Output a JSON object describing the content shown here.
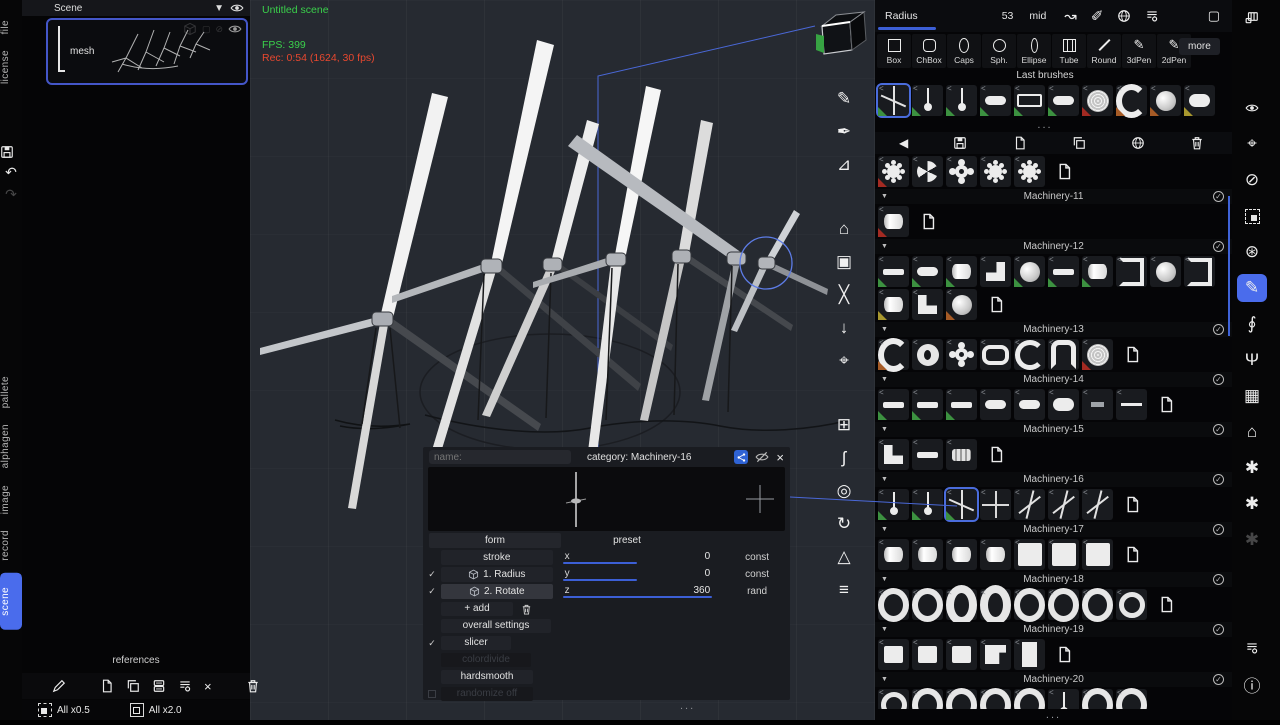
{
  "accent": {
    "blue": "#4a6cec",
    "slider": "#3c5fd6",
    "green": "#3ad04b",
    "red": "#e8482f"
  },
  "left_tabs": {
    "top": [
      {
        "label": "file"
      },
      {
        "label": "license"
      }
    ],
    "bottom": [
      {
        "label": "pallete"
      },
      {
        "label": "alphagen"
      },
      {
        "label": "image"
      },
      {
        "label": "record"
      },
      {
        "label": "scene",
        "active": true
      }
    ],
    "icons": [
      {
        "name": "save-icon",
        "glyph": "svg:floppy"
      },
      {
        "name": "undo-icon",
        "glyph": "↶"
      },
      {
        "name": "redo-icon",
        "glyph": "↷",
        "dim": true
      }
    ]
  },
  "scene_panel": {
    "title": "Scene",
    "mesh_label": "mesh",
    "references_label": "references",
    "scale_down_label": "All x0.5",
    "scale_up_label": "All x2.0",
    "header_icons": [
      {
        "name": "dropdown-arrow-icon",
        "glyph": "▼"
      },
      {
        "name": "visibility-eye-icon",
        "glyph": "svg:eye"
      }
    ],
    "item_icons": [
      {
        "name": "ghost-cube-icon",
        "glyph": "svg:cube",
        "dim": true
      },
      {
        "name": "ghost-frame-icon",
        "glyph": "▢",
        "dim": true
      },
      {
        "name": "ghost-hide-icon",
        "glyph": "⊘",
        "dim": true
      },
      {
        "name": "item-eye-icon",
        "glyph": "svg:eye"
      }
    ],
    "toolbar_icons": [
      {
        "name": "draw-icon",
        "glyph": "svg:pen"
      },
      {
        "name": "new-file-icon",
        "glyph": "svg:file",
        "gap": true
      },
      {
        "name": "duplicate-icon",
        "glyph": "svg:copy"
      },
      {
        "name": "layers-icon",
        "glyph": "svg:layers"
      },
      {
        "name": "list-settings-icon",
        "glyph": "svg:listgear"
      },
      {
        "name": "close-icon",
        "glyph": "×"
      },
      {
        "name": "trash-icon",
        "glyph": "svg:trash",
        "gap": true
      }
    ]
  },
  "viewport": {
    "scene_name": "Untitled scene",
    "fps": "FPS: 399",
    "rec": "Rec: 0:54 (1624, 30 fps)",
    "ellipsis": "..."
  },
  "middle_toolbar": [
    {
      "name": "pen-tool-icon",
      "glyph": "✎"
    },
    {
      "name": "mask-pen-icon",
      "glyph": "✒"
    },
    {
      "name": "chart-icon",
      "glyph": "⊿"
    },
    {
      "name": "home-icon",
      "glyph": "⌂",
      "gap": true
    },
    {
      "name": "frame-icon",
      "glyph": "▣"
    },
    {
      "name": "shuffle-icon",
      "glyph": "╳"
    },
    {
      "name": "arrow-down-icon",
      "glyph": "↓"
    },
    {
      "name": "move-icon",
      "glyph": "⌖"
    },
    {
      "name": "select-box-icon",
      "glyph": "⊞",
      "gap": true
    },
    {
      "name": "lasso-icon",
      "glyph": "ʃ"
    },
    {
      "name": "gyro-icon",
      "glyph": "◎"
    },
    {
      "name": "rotate-sphere-icon",
      "glyph": "↻"
    },
    {
      "name": "cone-icon",
      "glyph": "△"
    },
    {
      "name": "settings-list-icon",
      "glyph": "≡"
    }
  ],
  "right_toolbar": [
    {
      "name": "panels-icon",
      "glyph": "svg:panels"
    },
    {
      "name": "eye-icon",
      "glyph": "svg:eye",
      "gap": "lg"
    },
    {
      "name": "transform-move-icon",
      "glyph": "⌖"
    },
    {
      "name": "no-draw-icon",
      "glyph": "⊘"
    },
    {
      "name": "select-area-icon",
      "glyph": "css:selbox"
    },
    {
      "name": "grid-sphere-icon",
      "glyph": "⊛"
    },
    {
      "name": "pen-tool-icon",
      "glyph": "✎",
      "active": true
    },
    {
      "name": "lathe-icon",
      "glyph": "∮"
    },
    {
      "name": "plant-icon",
      "glyph": "Ψ"
    },
    {
      "name": "pattern-icon",
      "glyph": "▦"
    },
    {
      "name": "home-icon",
      "glyph": "⌂"
    },
    {
      "name": "nodes-icon",
      "glyph": "✱"
    },
    {
      "name": "nodes2-icon",
      "glyph": "✱"
    },
    {
      "name": "ghost-nodes-icon",
      "glyph": "✱",
      "dim": true
    },
    {
      "name": "settings-list-icon",
      "glyph": "svg:listgear",
      "gap": "xl"
    },
    {
      "name": "info-icon",
      "glyph": "ⓘ"
    }
  ],
  "top_bar": {
    "radius_label": "Radius",
    "radius_value": "53",
    "radius_mode": "mid",
    "icons": [
      {
        "name": "pose-path-icon",
        "glyph": "↝"
      },
      {
        "name": "pencil-ruler-icon",
        "glyph": "✐"
      },
      {
        "name": "globe-brush-icon",
        "glyph": "svg:globe"
      },
      {
        "name": "settings-list-icon",
        "glyph": "svg:listgear"
      }
    ],
    "window_icon": {
      "name": "window-icon",
      "glyph": "▢"
    }
  },
  "brush_types": {
    "items": [
      {
        "label": "Box",
        "icon": "box"
      },
      {
        "label": "ChBox",
        "icon": "chbox"
      },
      {
        "label": "Caps",
        "icon": "caps"
      },
      {
        "label": "Sph.",
        "icon": "sph"
      },
      {
        "label": "Ellipse",
        "icon": "ellipse"
      },
      {
        "label": "Tube",
        "icon": "tube"
      },
      {
        "label": "Round",
        "icon": "round"
      },
      {
        "label": "3dPen",
        "icon": "pen"
      },
      {
        "label": "2dPen",
        "icon": "pen"
      }
    ],
    "more_label": "more"
  },
  "last_brushes": {
    "label": "Last brushes",
    "ellipsis": "...",
    "thumbs": [
      {
        "t": "windmill",
        "c": "green",
        "sel": true
      },
      {
        "t": "pin",
        "c": "green"
      },
      {
        "t": "pin",
        "c": "green"
      },
      {
        "t": "capsule",
        "c": "green"
      },
      {
        "t": "barhollow",
        "c": "green"
      },
      {
        "t": "capsule",
        "c": "green"
      },
      {
        "t": "texdisc",
        "c": "red"
      },
      {
        "t": "crescent",
        "c": "orange"
      },
      {
        "t": "sphere",
        "c": "orange"
      },
      {
        "t": "caprnd",
        "c": "yellow"
      }
    ]
  },
  "library_toolbar": [
    {
      "name": "back-icon",
      "glyph": "◀"
    },
    {
      "name": "save-icon",
      "glyph": "svg:floppy"
    },
    {
      "name": "new-file-icon",
      "glyph": "svg:file"
    },
    {
      "name": "duplicate-icon",
      "glyph": "svg:copy"
    },
    {
      "name": "globe-icon",
      "glyph": "svg:globe"
    },
    {
      "name": "trash-icon",
      "glyph": "svg:trash"
    }
  ],
  "library": {
    "ellipsis": "...",
    "lead_thumbs": [
      {
        "t": "gear",
        "c": "red"
      },
      {
        "t": "fan"
      },
      {
        "t": "gearcross"
      },
      {
        "t": "gear"
      },
      {
        "t": "gear"
      },
      {
        "t": "file"
      }
    ],
    "sections": [
      {
        "title": "Machinery-11",
        "thumbs": [
          {
            "t": "cyl",
            "c": "red"
          },
          {
            "t": "file"
          }
        ]
      },
      {
        "title": "Machinery-12",
        "thumbs": [
          {
            "t": "bar",
            "c": "green"
          },
          {
            "t": "capsule",
            "c": "green"
          },
          {
            "t": "cyl",
            "c": "green"
          },
          {
            "t": "lcorner"
          },
          {
            "t": "sphere",
            "c": "green"
          },
          {
            "t": "bar",
            "c": "green"
          },
          {
            "t": "cyl",
            "c": "green"
          },
          {
            "t": "bracket"
          },
          {
            "t": "sphere"
          },
          {
            "t": "bracket"
          },
          {
            "t": "cyl",
            "c": "yellow"
          },
          {
            "t": "lshape"
          },
          {
            "t": "sphere",
            "c": "orange"
          },
          {
            "t": "file"
          }
        ]
      },
      {
        "title": "Machinery-13",
        "thumbs": [
          {
            "t": "crescent",
            "c": "orange"
          },
          {
            "t": "ringdisc"
          },
          {
            "t": "gearcross"
          },
          {
            "t": "capring"
          },
          {
            "t": "clamp"
          },
          {
            "t": "pipe"
          },
          {
            "t": "texdisc",
            "c": "red"
          },
          {
            "t": "file"
          }
        ]
      },
      {
        "title": "Machinery-14",
        "thumbs": [
          {
            "t": "bar",
            "c": "green"
          },
          {
            "t": "bar",
            "c": "green"
          },
          {
            "t": "bar",
            "c": "green"
          },
          {
            "t": "capsule"
          },
          {
            "t": "capsule"
          },
          {
            "t": "caprnd"
          },
          {
            "t": "barsm"
          },
          {
            "t": "barthin"
          },
          {
            "t": "file"
          }
        ]
      },
      {
        "title": "Machinery-15",
        "thumbs": [
          {
            "t": "lshape"
          },
          {
            "t": "bar"
          },
          {
            "t": "boltcyl"
          },
          {
            "t": "file"
          }
        ]
      },
      {
        "title": "Machinery-16",
        "thumbs": [
          {
            "t": "pin",
            "c": "green"
          },
          {
            "t": "pin",
            "c": "green"
          },
          {
            "t": "windmill",
            "c": "green",
            "sel": true
          },
          {
            "t": "cross"
          },
          {
            "t": "windmill3"
          },
          {
            "t": "windmill3"
          },
          {
            "t": "windmill3"
          },
          {
            "t": "file"
          }
        ]
      },
      {
        "title": "Machinery-17",
        "thumbs": [
          {
            "t": "cyl"
          },
          {
            "t": "cyl"
          },
          {
            "t": "cyl"
          },
          {
            "t": "cyl"
          },
          {
            "t": "blockbig"
          },
          {
            "t": "blockbig"
          },
          {
            "t": "blockbig"
          },
          {
            "t": "file"
          }
        ]
      },
      {
        "title": "Machinery-18",
        "thumbs": [
          {
            "t": "ring"
          },
          {
            "t": "ring"
          },
          {
            "t": "ringwide"
          },
          {
            "t": "ringwide"
          },
          {
            "t": "ring"
          },
          {
            "t": "ring"
          },
          {
            "t": "ring"
          },
          {
            "t": "ringsm"
          },
          {
            "t": "file"
          }
        ]
      },
      {
        "title": "Machinery-19",
        "thumbs": [
          {
            "t": "block"
          },
          {
            "t": "block"
          },
          {
            "t": "block"
          },
          {
            "t": "blocknotch"
          },
          {
            "t": "blocktall"
          },
          {
            "t": "file"
          }
        ]
      },
      {
        "title": "Machinery-20",
        "clipped": true,
        "thumbs": [
          {
            "t": "ringsm"
          },
          {
            "t": "ring"
          },
          {
            "t": "ring"
          },
          {
            "t": "ring"
          },
          {
            "t": "ring"
          },
          {
            "t": "pin"
          },
          {
            "t": "ring"
          },
          {
            "t": "ring"
          }
        ]
      }
    ]
  },
  "dialog": {
    "name_label": "name:",
    "category": "category: Machinery-16",
    "close": "×",
    "tabs": {
      "form": "form",
      "preset": "preset"
    },
    "rows": [
      {
        "check": "",
        "label": "stroke",
        "axis": "x",
        "value": "0",
        "mode": "const",
        "fill": 0.5,
        "hl": false,
        "cube": false
      },
      {
        "check": "✓",
        "label": "1. Radius",
        "axis": "y",
        "value": "0",
        "mode": "const",
        "fill": 0.5,
        "hl": false,
        "cube": true
      },
      {
        "check": "✓",
        "label": "2. Rotate",
        "axis": "z",
        "value": "360",
        "mode": "rand",
        "fill": 1.0,
        "hl": true,
        "cube": true
      }
    ],
    "add_label": "+ add",
    "overall_label": "overall settings",
    "slicer_check": "✓",
    "slicer_label": "slicer",
    "dim1_label": "colordivide",
    "hardsmooth_label": "hardsmooth",
    "dim2_label": "randomize off"
  }
}
